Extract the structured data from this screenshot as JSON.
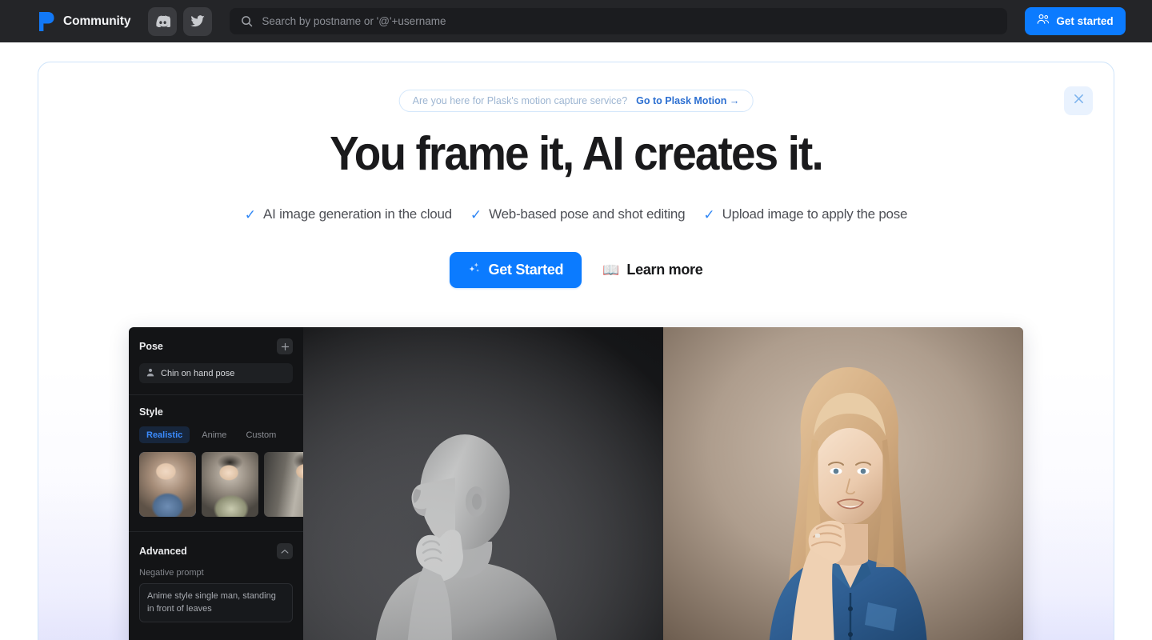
{
  "navbar": {
    "logo_icon": "plask-logo-icon",
    "brand": "Community",
    "social": [
      {
        "name": "discord",
        "icon": "discord-icon"
      },
      {
        "name": "twitter",
        "icon": "twitter-icon"
      }
    ],
    "search": {
      "icon": "search-icon",
      "placeholder": "Search by postname or '@'+username",
      "value": ""
    },
    "get_started": {
      "icon": "users-icon",
      "label": "Get started"
    }
  },
  "hero": {
    "close_icon": "close-icon",
    "promo": {
      "question": "Are you here for Plask's motion capture service?",
      "link": "Go to Plask Motion →"
    },
    "headline": "You frame it, AI creates it.",
    "features": [
      {
        "check": "✓",
        "text": "AI image generation in the cloud"
      },
      {
        "check": "✓",
        "text": "Web-based pose and shot editing"
      },
      {
        "check": "✓",
        "text": "Upload image to apply the pose"
      }
    ],
    "cta_primary": {
      "icon": "sparkles-icon",
      "label": "Get Started"
    },
    "cta_secondary": {
      "icon": "📖",
      "label": "Learn more"
    }
  },
  "app_mock": {
    "pose": {
      "title": "Pose",
      "add_icon": "plus-icon",
      "chip_icon": "person-icon",
      "chip_label": "Chin on hand pose"
    },
    "style": {
      "title": "Style",
      "tabs": [
        {
          "label": "Realistic",
          "active": true
        },
        {
          "label": "Anime",
          "active": false
        },
        {
          "label": "Custom",
          "active": false
        }
      ],
      "thumbnails": [
        {
          "name": "style-thumb-realistic-portrait",
          "selected": true
        },
        {
          "name": "style-thumb-anime-geisha",
          "selected": false
        },
        {
          "name": "style-thumb-interior-portrait",
          "selected": false
        }
      ]
    },
    "advanced": {
      "title": "Advanced",
      "collapse_icon": "chevron-up-icon",
      "negative_prompt_label": "Negative prompt",
      "negative_prompt_value": "Anime style single man, standing in front of leaves"
    },
    "viewport": {
      "name": "3d-pose-viewport",
      "subject": "gray-mannequin-chin-on-hand"
    },
    "result": {
      "name": "generated-image-result",
      "subject": "woman-denim-shirt-chin-on-hand"
    }
  },
  "colors": {
    "accent_blue": "#0B7BFF",
    "navbar_bg": "#242528",
    "card_border": "#CFE4FA",
    "dark_panel": "#131416"
  }
}
